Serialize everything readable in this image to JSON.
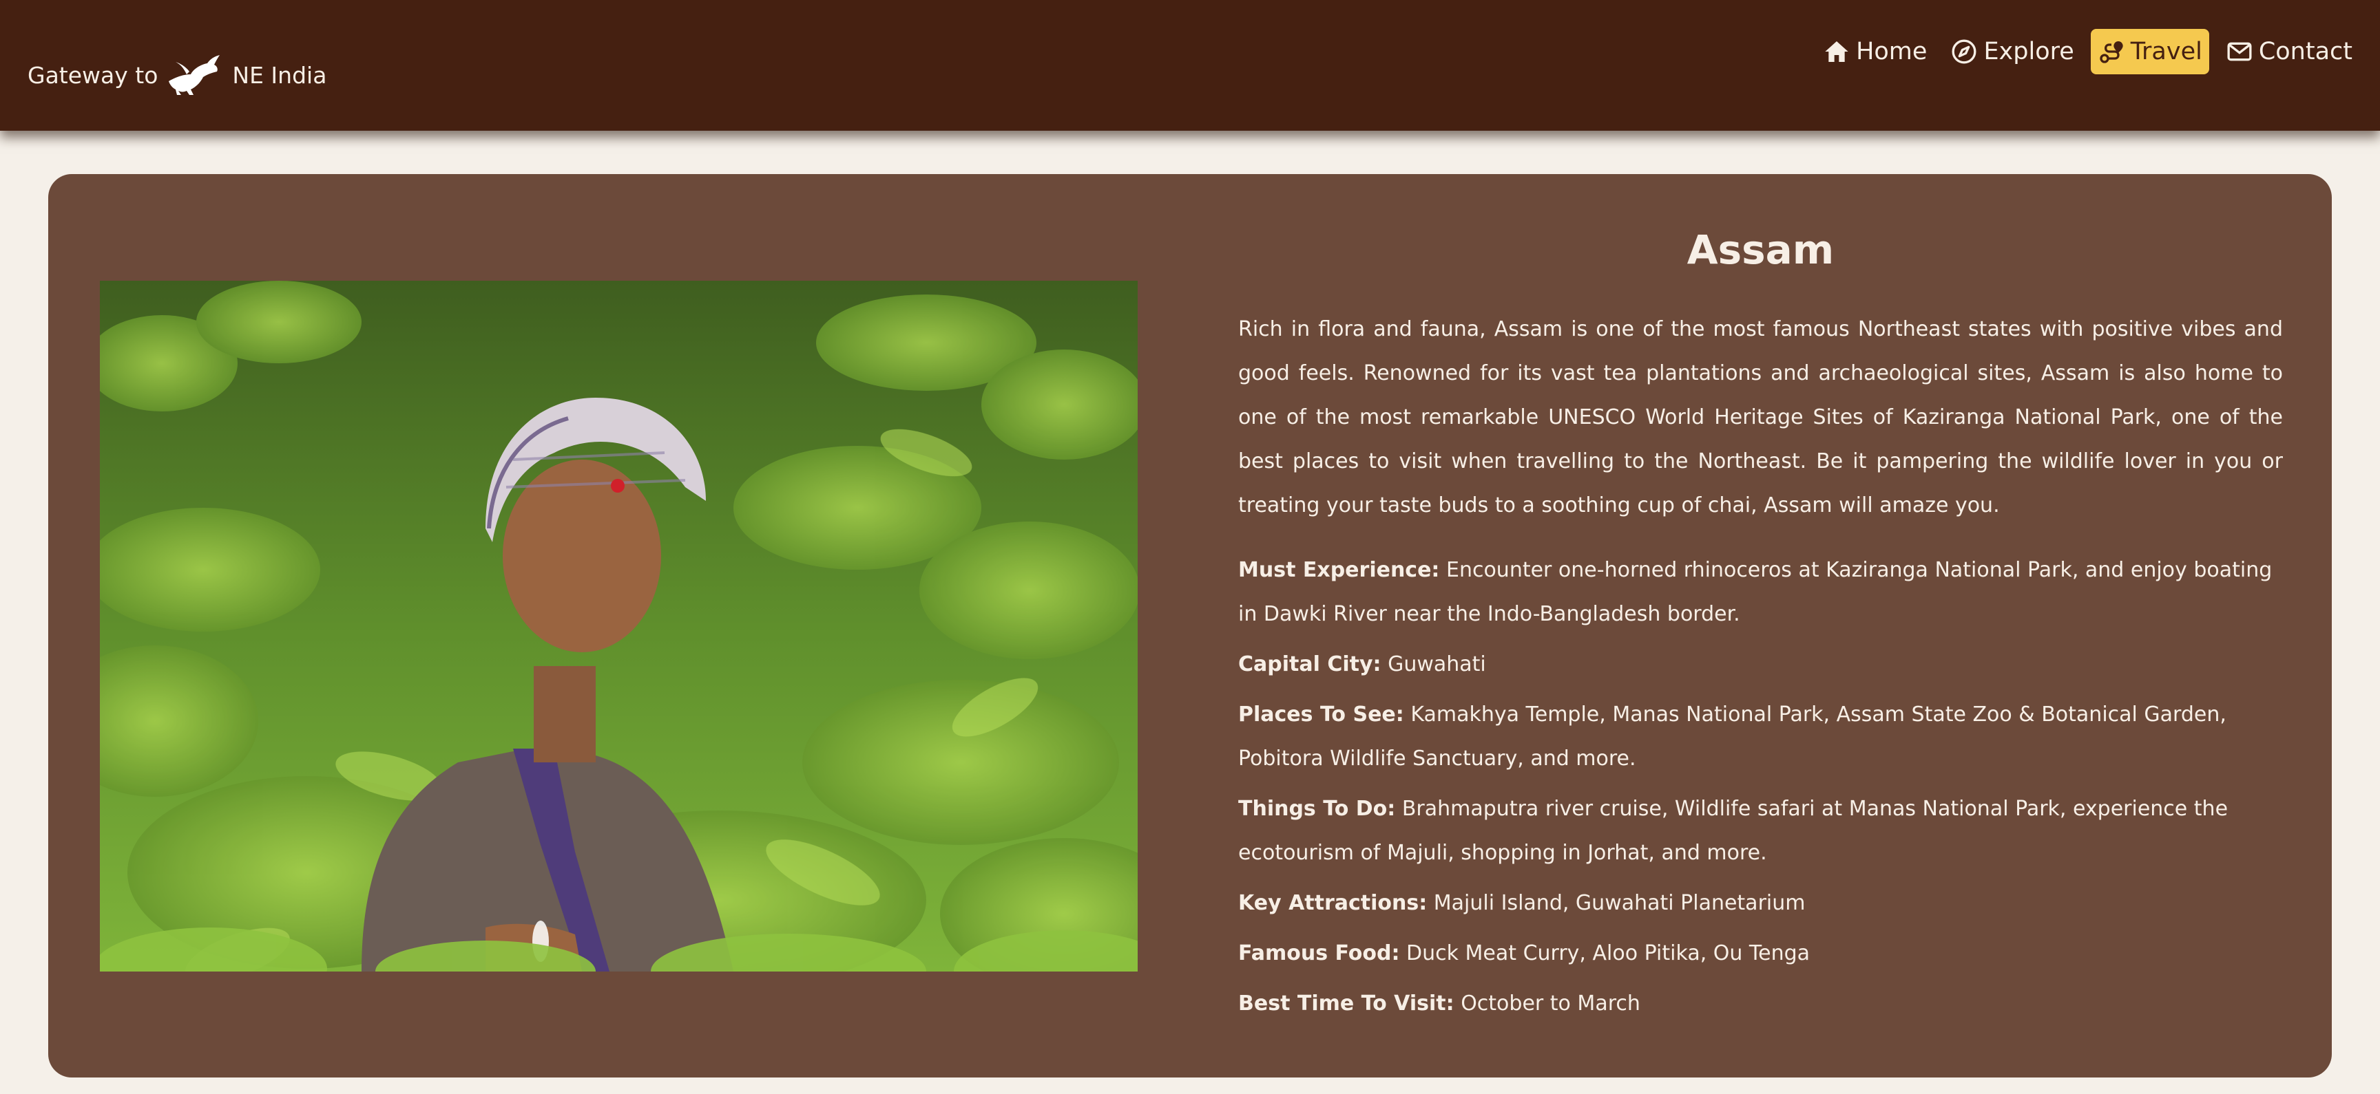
{
  "navbar": {
    "brand_prefix": "Gateway to",
    "brand_suffix": "NE India",
    "brand_icon": "bird-icon",
    "items": [
      {
        "label": "Home",
        "icon": "home-icon",
        "active": false
      },
      {
        "label": "Explore",
        "icon": "compass-icon",
        "active": false
      },
      {
        "label": "Travel",
        "icon": "route-icon",
        "active": true
      },
      {
        "label": "Contact",
        "icon": "envelope-icon",
        "active": false
      }
    ]
  },
  "colors": {
    "navbar_bg": "#452011",
    "page_bg": "#f5f0e9",
    "card_bg": "#6c4a3a",
    "active_tab": "#f5c94f",
    "text": "#f7efe6"
  },
  "state": {
    "title": "Assam",
    "description": "Rich in flora and fauna, Assam is one of the most famous Northeast states with positive vibes and good feels. Renowned for its vast tea plantations and archaeological sites, Assam is also home to one of the most remarkable UNESCO World Heritage Sites of Kaziranga National Park, one of the best places to visit when travelling to the Northeast. Be it pampering the wildlife lover in you or treating your taste buds to a soothing cup of chai, Assam will amaze you.",
    "facts": [
      {
        "label": "Must Experience:",
        "value": "Encounter one-horned rhinoceros at Kaziranga National Park, and enjoy boating in Dawki River near the Indo-Bangladesh border."
      },
      {
        "label": "Capital City:",
        "value": "Guwahati"
      },
      {
        "label": "Places To See:",
        "value": "Kamakhya Temple, Manas National Park, Assam State Zoo & Botanical Garden, Pobitora Wildlife Sanctuary, and more."
      },
      {
        "label": "Things To Do:",
        "value": "Brahmaputra river cruise, Wildlife safari at Manas National Park, experience the ecotourism of Majuli, shopping in Jorhat, and more."
      },
      {
        "label": "Key Attractions:",
        "value": "Majuli Island, Guwahati Planetarium"
      },
      {
        "label": "Famous Food:",
        "value": "Duck Meat Curry, Aloo Pitika, Ou Tenga"
      },
      {
        "label": "Best Time To Visit:",
        "value": "October to March"
      }
    ]
  }
}
